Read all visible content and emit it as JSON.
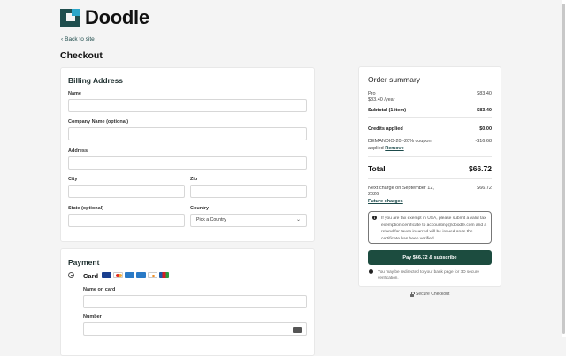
{
  "brand": {
    "name": "Doodle"
  },
  "nav": {
    "back_label": "Back to site"
  },
  "page": {
    "title": "Checkout"
  },
  "billing": {
    "heading": "Billing Address",
    "name_label": "Name",
    "company_label": "Company Name (optional)",
    "address_label": "Address",
    "city_label": "City",
    "zip_label": "Zip",
    "state_label": "State (optional)",
    "country_label": "Country",
    "country_value": "Pick a Country"
  },
  "payment": {
    "heading": "Payment",
    "method_label": "Card",
    "card_brands": [
      "Visa",
      "Mastercard",
      "Generic card",
      "American Express",
      "Discover",
      "JCB"
    ],
    "name_on_card_label": "Name on card",
    "number_label": "Number"
  },
  "summary": {
    "heading": "Order summary",
    "plan_name": "Pro",
    "plan_price": "$83.40",
    "plan_period": "$83.40 /year",
    "subtotal_label": "Subtotal (1 item)",
    "subtotal_value": "$83.40",
    "credits_label": "Credits applied",
    "credits_value": "$0.00",
    "coupon_line1": "DEMANDIO-20 -20% coupon",
    "coupon_line2": "applied",
    "coupon_remove": "Remove",
    "coupon_value": "-$16.68",
    "total_label": "Total",
    "total_value": "$66.72",
    "next_charge_line1": "Next charge on September 12,",
    "next_charge_line2": "2026",
    "next_charge_value": "$66.72",
    "future_charges": "Future charges",
    "tax_notice": "If you are tax exempt in USA, please submit a valid tax exemption certificate to accounting@doodle.com and a refund for taxes incurred will be issued once the certificate has been verified.",
    "pay_button": "Pay $66.72 & subscribe",
    "redirect_notice": "You may be redirected to your bank page for 3D secure verification.",
    "secure_label": "Secure Checkout"
  },
  "colors": {
    "accent": "#1c4c3f",
    "logo_dark": "#1f4e4e",
    "logo_light": "#2ba6c9",
    "background": "#f4f4f4"
  }
}
